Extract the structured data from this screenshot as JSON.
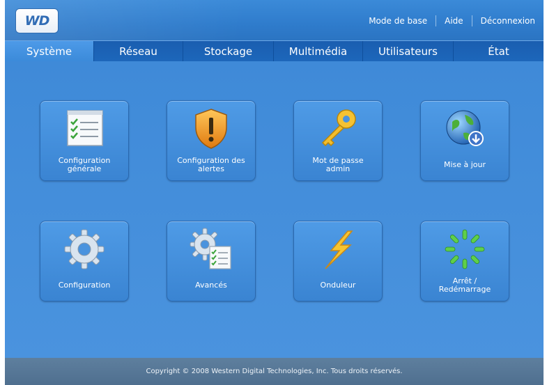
{
  "brand": {
    "logo_text": "WD"
  },
  "toplinks": {
    "basic_mode": "Mode de base",
    "help": "Aide",
    "logout": "Déconnexion"
  },
  "tabs": [
    {
      "label": "Système",
      "active": true
    },
    {
      "label": "Réseau"
    },
    {
      "label": "Stockage"
    },
    {
      "label": "Multimédia"
    },
    {
      "label": "Utilisateurs"
    },
    {
      "label": "État"
    }
  ],
  "tiles": [
    {
      "label": "Configuration\ngénérale",
      "icon": "checklist-icon"
    },
    {
      "label": "Configuration des\nalertes",
      "icon": "warning-shield-icon"
    },
    {
      "label": "Mot de passe\nadmin",
      "icon": "key-icon"
    },
    {
      "label": "Mise à jour",
      "icon": "globe-download-icon"
    },
    {
      "label": "Configuration",
      "icon": "gear-icon"
    },
    {
      "label": "Avancés",
      "icon": "gears-checklist-icon"
    },
    {
      "label": "Onduleur",
      "icon": "lightning-icon"
    },
    {
      "label": "Arrêt /\nRedémarrage",
      "icon": "spinner-icon"
    }
  ],
  "footer": {
    "copyright": "Copyright © 2008 Western Digital Technologies, Inc. Tous droits réservés."
  },
  "colors": {
    "background": "#4a8ed8",
    "tab_bar": "#1d67bb",
    "active_tab": "#3b8ad9",
    "footer": "#557592"
  }
}
